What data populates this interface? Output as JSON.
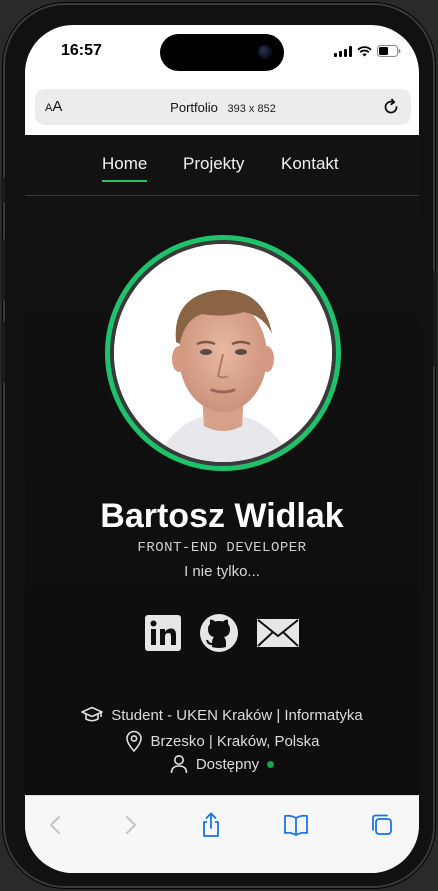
{
  "status": {
    "time": "16:57"
  },
  "browser": {
    "aa": "A",
    "aa_big": "A",
    "page_title": "Portfolio",
    "viewport": "393 x 852"
  },
  "nav": {
    "items": [
      "Home",
      "Projekty",
      "Kontakt"
    ],
    "active": "Home"
  },
  "profile": {
    "name": "Bartosz Widlak",
    "role": "FRONT-END DEVELOPER",
    "tagline": "I nie tylko..."
  },
  "socials": [
    "linkedin-icon",
    "github-icon",
    "mail-icon"
  ],
  "info": {
    "education": "Student - UKEN Kraków | Informatyka",
    "location": "Brzesko | Kraków, Polska",
    "availability": "Dostępny"
  },
  "colors": {
    "accent": "#1ec26a",
    "available": "#16a34a",
    "background": "#0f0f0f",
    "link_blue": "#1a73e8"
  }
}
